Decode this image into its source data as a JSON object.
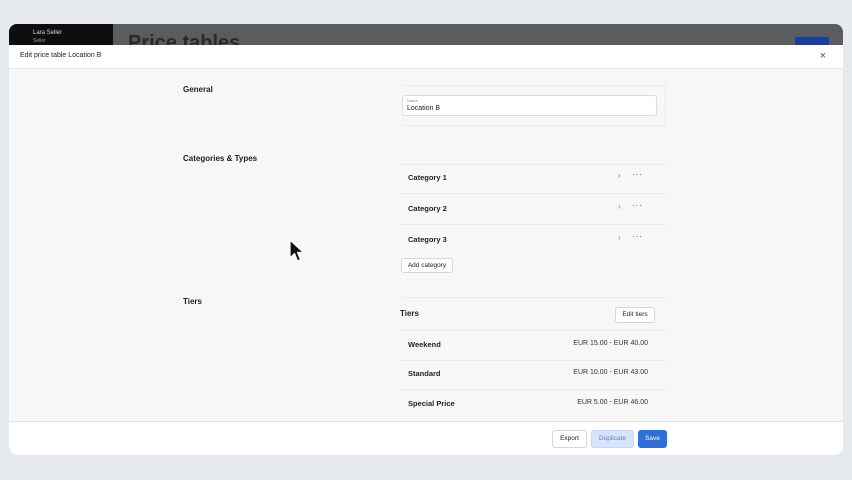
{
  "background": {
    "user_name": "Lara Seller",
    "user_sub": "Seller",
    "page_title": "Price tables"
  },
  "modal": {
    "title": "Edit price table Location B",
    "close_symbol": "×"
  },
  "general": {
    "label": "General",
    "name_field": {
      "label": "Name",
      "value": "Location B"
    }
  },
  "categories": {
    "label": "Categories & Types",
    "items": [
      {
        "label": "Category 1"
      },
      {
        "label": "Category 2"
      },
      {
        "label": "Category 3"
      }
    ],
    "add_label": "Add category",
    "chevron_symbol": "›",
    "more_symbol": "···"
  },
  "tiers": {
    "label": "Tiers",
    "box_title": "Tiers",
    "edit_label": "Edit tiers",
    "items": [
      {
        "name": "Weekend",
        "range": "EUR 15.00 - EUR 40.00"
      },
      {
        "name": "Standard",
        "range": "EUR 10.00 - EUR 43.00"
      },
      {
        "name": "Special Price",
        "range": "EUR 5.00 - EUR 46.00"
      }
    ]
  },
  "footer": {
    "export_label": "Export",
    "duplicate_label": "Duplicate",
    "save_label": "Save"
  },
  "colors": {
    "accent": "#2f6fd6",
    "duplicate_bg": "#d7e4fb",
    "overlay_bg": "#5b5c5e",
    "sidebar_bg": "#0e0e10"
  }
}
